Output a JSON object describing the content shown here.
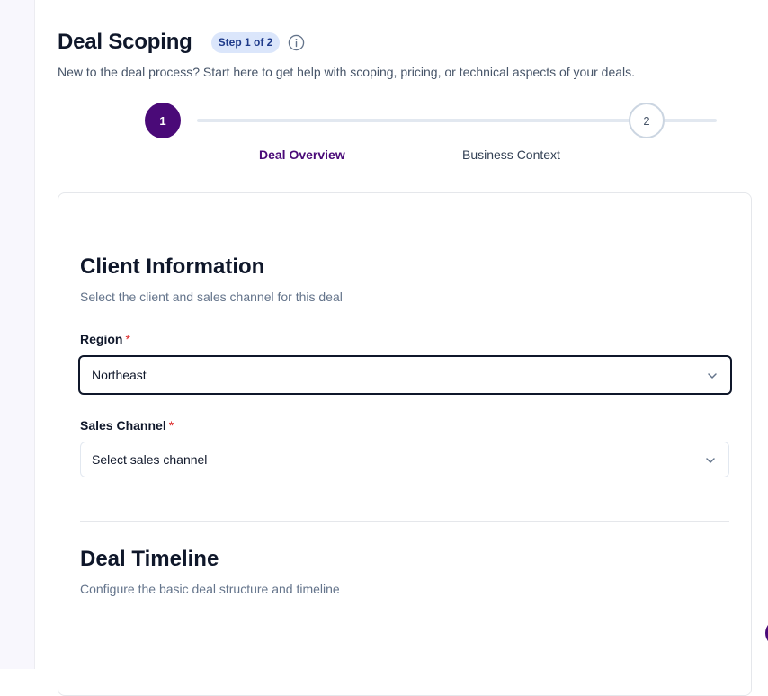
{
  "header": {
    "title": "Deal Scoping",
    "step_badge": "Step 1 of 2",
    "info_icon": "info-circle-icon",
    "subtitle": "New to the deal process? Start here to get help with scoping, pricing, or technical aspects of your deals."
  },
  "stepper": {
    "steps": [
      {
        "number": "1",
        "label": "Deal Overview",
        "state": "active"
      },
      {
        "number": "2",
        "label": "Business Context",
        "state": "upcoming"
      }
    ]
  },
  "client_info": {
    "title": "Client Information",
    "description": "Select the client and sales channel for this deal",
    "region": {
      "label": "Region",
      "required_mark": "*",
      "value": "Northeast",
      "icon": "chevron-down-icon"
    },
    "sales_channel": {
      "label": "Sales Channel",
      "required_mark": "*",
      "placeholder": "Select sales channel",
      "icon": "chevron-down-icon"
    }
  },
  "deal_timeline": {
    "title": "Deal Timeline",
    "description": "Configure the basic deal structure and timeline"
  },
  "colors": {
    "accent": "#4a0a78",
    "badge_bg": "#dbe6fb",
    "badge_text": "#1e3a8a",
    "required": "#dc2626"
  }
}
